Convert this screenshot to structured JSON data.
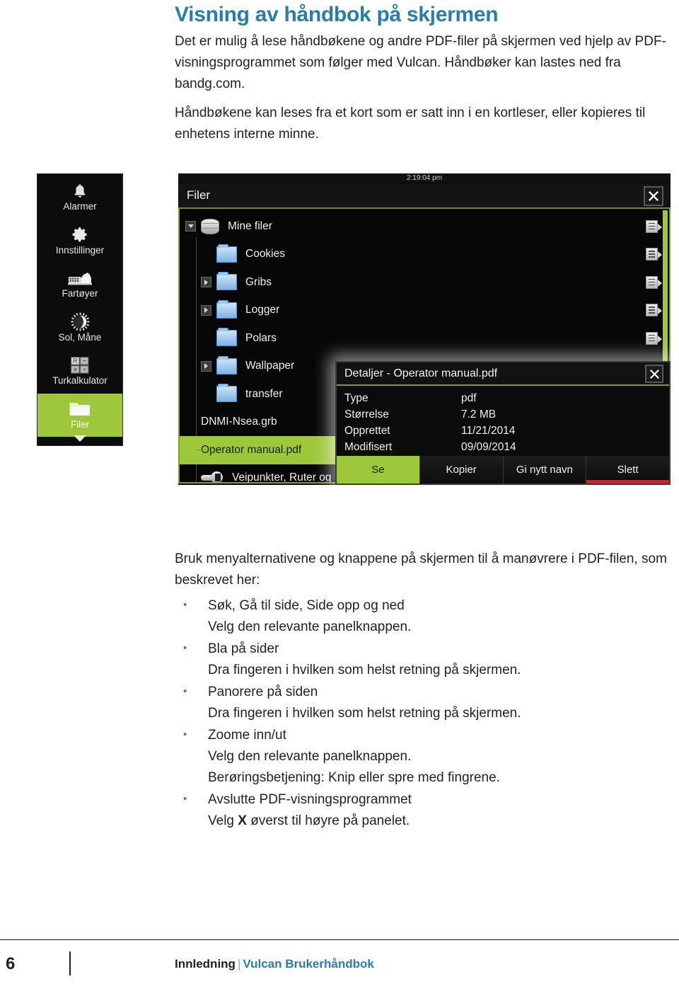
{
  "document": {
    "heading": "Visning av håndbok på skjermen",
    "paragraph1": "Det er mulig å lese håndbøkene og andre PDF-filer på skjermen ved hjelp av PDF-visningsprogrammet som følger med Vulcan. Håndbøker kan lastes ned fra bandg.com.",
    "paragraph2": "Håndbøkene kan leses fra et kort som er satt inn i en kortleser, eller kopieres til enhetens interne minne.",
    "lead": "Bruk menyalternativene og knappene på skjermen til å manøvrere i PDF-filen, som beskrevet her:",
    "bullets": [
      {
        "title": "Søk, Gå til side, Side opp og ned",
        "lines": [
          "Velg den relevante panelknappen."
        ]
      },
      {
        "title": "Bla på sider",
        "lines": [
          "Dra fingeren i hvilken som helst retning på skjermen."
        ]
      },
      {
        "title": "Panorere på siden",
        "lines": [
          "Dra fingeren i hvilken som helst retning på skjermen."
        ]
      },
      {
        "title": "Zoome inn/ut",
        "lines": [
          "Velg den relevante panelknappen.",
          "Berøringsbetjening: Knip eller spre med fingrene."
        ]
      },
      {
        "title": "Avslutte PDF-visningsprogrammet",
        "lines": [
          "Velg X øverst til høyre på panelet."
        ]
      }
    ]
  },
  "footer": {
    "page_number": "6",
    "section": "Innledning",
    "separator": "|",
    "book": "Vulcan Brukerhåndbok"
  },
  "screenshot": {
    "sidebar": {
      "items": [
        {
          "label": "Alarmer",
          "icon": "bell-icon",
          "active": false
        },
        {
          "label": "Innstillinger",
          "icon": "gear-icon",
          "active": false
        },
        {
          "label": "Fartøyer",
          "icon": "vessel-icon",
          "active": false
        },
        {
          "label": "Sol, Måne",
          "icon": "sun-moon-icon",
          "active": false
        },
        {
          "label": "Turkalkulator",
          "icon": "calculator-icon",
          "active": false
        },
        {
          "label": "Filer",
          "icon": "folder-icon",
          "active": true
        }
      ]
    },
    "panel": {
      "time": "2:19:04 pm",
      "title": "Filer",
      "close_label": "✕",
      "rows": [
        {
          "name": "Mine filer",
          "icon": "database-icon",
          "twisty": "down",
          "indent": 0,
          "selected": false,
          "menu": true
        },
        {
          "name": "Cookies",
          "icon": "folder-icon",
          "twisty": "none",
          "indent": 1,
          "selected": false,
          "menu": true
        },
        {
          "name": "Gribs",
          "icon": "folder-icon",
          "twisty": "right",
          "indent": 1,
          "selected": false,
          "menu": true
        },
        {
          "name": "Logger",
          "icon": "folder-icon",
          "twisty": "right",
          "indent": 1,
          "selected": false,
          "menu": true
        },
        {
          "name": "Polars",
          "icon": "folder-icon",
          "twisty": "none",
          "indent": 1,
          "selected": false,
          "menu": true
        },
        {
          "name": "Wallpaper",
          "icon": "folder-icon",
          "twisty": "right",
          "indent": 1,
          "selected": false,
          "menu": false
        },
        {
          "name": "transfer",
          "icon": "folder-icon",
          "twisty": "none",
          "indent": 1,
          "selected": false,
          "menu": false
        },
        {
          "name": "DNMI-Nsea.grb",
          "icon": "none",
          "twisty": "none",
          "indent": 1,
          "selected": false,
          "menu": false
        },
        {
          "name": "Operator manual.pdf",
          "icon": "none",
          "twisty": "none",
          "indent": 1,
          "selected": true,
          "menu": false
        },
        {
          "name": "Veipunkter, Ruter og S",
          "icon": "waypoint-icon",
          "twisty": "none",
          "indent": 0,
          "selected": false,
          "menu": false
        }
      ]
    },
    "dialog": {
      "title": "Detaljer - Operator manual.pdf",
      "close_label": "✕",
      "fields": [
        {
          "key": "Type",
          "value": "pdf"
        },
        {
          "key": "Størrelse",
          "value": "7.2 MB"
        },
        {
          "key": "Opprettet",
          "value": "11/21/2014"
        },
        {
          "key": "Modifisert",
          "value": "09/09/2014"
        }
      ],
      "buttons": [
        {
          "label": "Se",
          "style": "primary"
        },
        {
          "label": "Kopier",
          "style": "normal"
        },
        {
          "label": "Gi nytt navn",
          "style": "normal"
        },
        {
          "label": "Slett",
          "style": "danger"
        }
      ]
    }
  },
  "colors": {
    "heading_blue": "#2b7ca6",
    "accent_green": "#9fc73c",
    "danger_red": "#c0272d",
    "panel_black": "#060606"
  }
}
